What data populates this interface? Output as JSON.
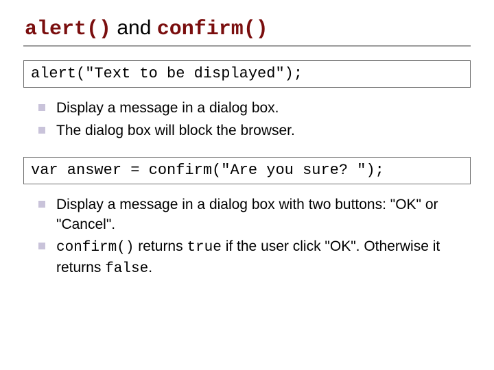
{
  "title": {
    "part1": "alert()",
    "and": " and ",
    "part2": "confirm()"
  },
  "codebox1": "alert(\"Text to be displayed\");",
  "bullets1": {
    "b0": "Display a message in a dialog box.",
    "b1": "The dialog box will block the browser."
  },
  "codebox2": "var answer = confirm(\"Are you sure? \");",
  "bullets2": {
    "b0": "Display a message in a dialog box with two buttons: \"OK\" or \"Cancel\".",
    "b1_code1": "confirm()",
    "b1_mid1": " returns ",
    "b1_code2": "true",
    "b1_mid2": " if the user click \"OK\". Otherwise it returns ",
    "b1_code3": "false",
    "b1_end": "."
  }
}
